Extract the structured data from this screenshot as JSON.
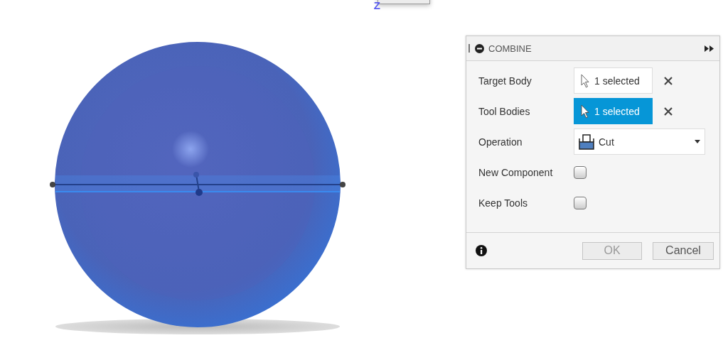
{
  "viewport": {
    "axis_label": "Z"
  },
  "dialog": {
    "title": "COMBINE",
    "rows": [
      {
        "kind": "selection",
        "label": "Target Body",
        "value": "1 selected",
        "selected": false
      },
      {
        "kind": "selection",
        "label": "Tool Bodies",
        "value": "1 selected",
        "selected": true
      },
      {
        "kind": "dropdown",
        "label": "Operation",
        "value": "Cut"
      },
      {
        "kind": "checkbox",
        "label": "New Component",
        "checked": false
      },
      {
        "kind": "checkbox",
        "label": "Keep Tools",
        "checked": false
      }
    ],
    "buttons": [
      {
        "label": "OK",
        "disabled": true
      },
      {
        "label": "Cancel",
        "disabled": false
      }
    ]
  }
}
